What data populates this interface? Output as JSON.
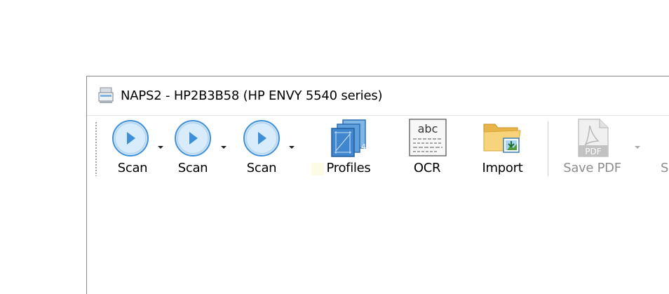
{
  "window": {
    "title": "NAPS2 - HP2B3B58 (HP ENVY 5540 series)"
  },
  "toolbar": {
    "scan1_label": "Scan",
    "scan2_label": "Scan",
    "scan3_label": "Scan",
    "profiles_label": "Profiles",
    "ocr_label": "OCR",
    "ocr_icon_text": "abc",
    "import_label": "Import",
    "save_pdf_label": "Save PDF",
    "save_pdf_icon_text": "PDF",
    "partial_next_label": "S"
  },
  "icons": {
    "app": "scanner-icon",
    "scan": "play-circle-icon",
    "profiles": "profiles-icon",
    "ocr": "ocr-document-icon",
    "import": "folder-import-icon",
    "save_pdf": "pdf-file-icon"
  },
  "colors": {
    "scan_blue": "#3f8fd7",
    "scan_fill": "#d9ecfb",
    "folder_yellow": "#f4c95d",
    "disabled_text": "#8d8d8d"
  }
}
